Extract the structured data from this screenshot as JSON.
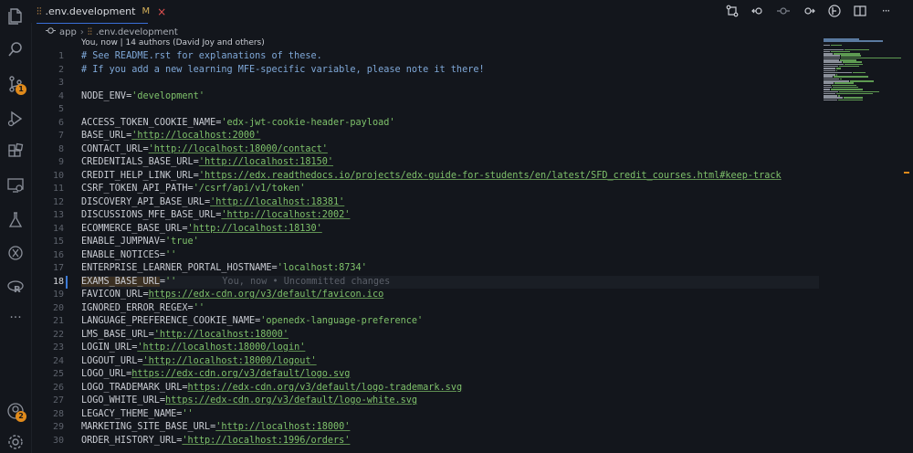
{
  "tab": {
    "icon": "settings-sliders-icon",
    "filename": ".env.development",
    "status": "M",
    "close": "×"
  },
  "breadcrumb": {
    "folder": "app",
    "file": ".env.development"
  },
  "blame_header": "You, now | 14 authors (David Joy and others)",
  "activity_badges": {
    "source_control": "1",
    "accounts": "2"
  },
  "colors": {
    "accent": "#e08a1b",
    "string": "#7fc26b",
    "comment": "#7fa8d8",
    "tab_close": "#e05050"
  },
  "editor": {
    "current_line": 18,
    "inline_blame": "You, now • Uncommitted changes",
    "lines": [
      {
        "n": "1",
        "type": "comment",
        "text": "# See README.rst for explanations of these."
      },
      {
        "n": "2",
        "type": "comment",
        "text": "# If you add a new learning MFE-specific variable, please note it there!"
      },
      {
        "n": "3",
        "type": "blank"
      },
      {
        "n": "4",
        "type": "kv",
        "key": "NODE_ENV",
        "value": "'development'",
        "url": false
      },
      {
        "n": "5",
        "type": "blank"
      },
      {
        "n": "6",
        "type": "kv",
        "key": "ACCESS_TOKEN_COOKIE_NAME",
        "value": "'edx-jwt-cookie-header-payload'",
        "url": false
      },
      {
        "n": "7",
        "type": "kv",
        "key": "BASE_URL",
        "value": "'http://localhost:2000'",
        "url": true
      },
      {
        "n": "8",
        "type": "kv",
        "key": "CONTACT_URL",
        "value": "'http://localhost:18000/contact'",
        "url": true
      },
      {
        "n": "9",
        "type": "kv",
        "key": "CREDENTIALS_BASE_URL",
        "value": "'http://localhost:18150'",
        "url": true
      },
      {
        "n": "10",
        "type": "kv",
        "key": "CREDIT_HELP_LINK_URL",
        "value": "'https://edx.readthedocs.io/projects/edx-guide-for-students/en/latest/SFD_credit_courses.html#keep-track",
        "url": true
      },
      {
        "n": "11",
        "type": "kv",
        "key": "CSRF_TOKEN_API_PATH",
        "value": "'/csrf/api/v1/token'",
        "url": false
      },
      {
        "n": "12",
        "type": "kv",
        "key": "DISCOVERY_API_BASE_URL",
        "value": "'http://localhost:18381'",
        "url": true
      },
      {
        "n": "13",
        "type": "kv",
        "key": "DISCUSSIONS_MFE_BASE_URL",
        "value": "'http://localhost:2002'",
        "url": true
      },
      {
        "n": "14",
        "type": "kv",
        "key": "ECOMMERCE_BASE_URL",
        "value": "'http://localhost:18130'",
        "url": true
      },
      {
        "n": "15",
        "type": "kv",
        "key": "ENABLE_JUMPNAV",
        "value": "'true'",
        "url": false
      },
      {
        "n": "16",
        "type": "kv",
        "key": "ENABLE_NOTICES",
        "value": "''",
        "url": false
      },
      {
        "n": "17",
        "type": "kv",
        "key": "ENTERPRISE_LEARNER_PORTAL_HOSTNAME",
        "value": "'localhost:8734'",
        "url": false
      },
      {
        "n": "18",
        "type": "kv",
        "key": "EXAMS_BASE_URL",
        "value": "''",
        "url": false
      },
      {
        "n": "19",
        "type": "kv",
        "key": "FAVICON_URL",
        "value": "https://edx-cdn.org/v3/default/favicon.ico",
        "url": true
      },
      {
        "n": "20",
        "type": "kv",
        "key": "IGNORED_ERROR_REGEX",
        "value": "''",
        "url": false
      },
      {
        "n": "21",
        "type": "kv",
        "key": "LANGUAGE_PREFERENCE_COOKIE_NAME",
        "value": "'openedx-language-preference'",
        "url": false
      },
      {
        "n": "22",
        "type": "kv",
        "key": "LMS_BASE_URL",
        "value": "'http://localhost:18000'",
        "url": true
      },
      {
        "n": "23",
        "type": "kv",
        "key": "LOGIN_URL",
        "value": "'http://localhost:18000/login'",
        "url": true
      },
      {
        "n": "24",
        "type": "kv",
        "key": "LOGOUT_URL",
        "value": "'http://localhost:18000/logout'",
        "url": true
      },
      {
        "n": "25",
        "type": "kv",
        "key": "LOGO_URL",
        "value": "https://edx-cdn.org/v3/default/logo.svg",
        "url": true
      },
      {
        "n": "26",
        "type": "kv",
        "key": "LOGO_TRADEMARK_URL",
        "value": "https://edx-cdn.org/v3/default/logo-trademark.svg",
        "url": true
      },
      {
        "n": "27",
        "type": "kv",
        "key": "LOGO_WHITE_URL",
        "value": "https://edx-cdn.org/v3/default/logo-white.svg",
        "url": true
      },
      {
        "n": "28",
        "type": "kv",
        "key": "LEGACY_THEME_NAME",
        "value": "''",
        "url": false
      },
      {
        "n": "29",
        "type": "kv",
        "key": "MARKETING_SITE_BASE_URL",
        "value": "'http://localhost:18000'",
        "url": true
      },
      {
        "n": "30",
        "type": "kv",
        "key": "ORDER_HISTORY_URL",
        "value": "'http://localhost:1996/orders'",
        "url": true
      }
    ]
  }
}
